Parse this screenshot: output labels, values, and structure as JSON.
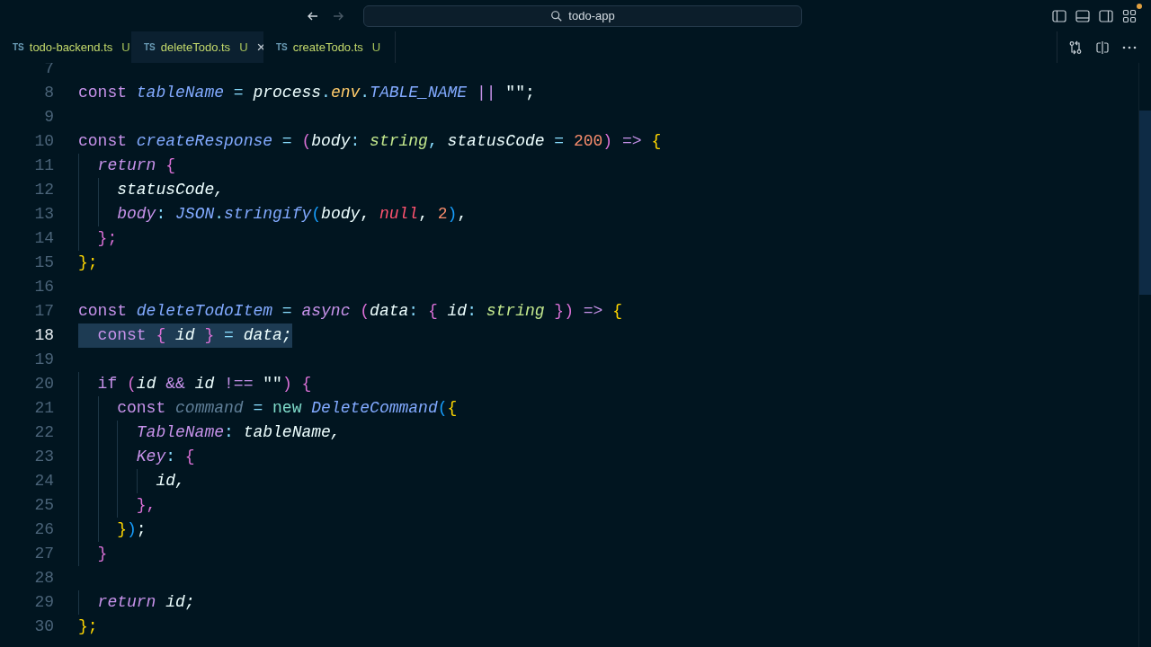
{
  "title_bar": {
    "search": {
      "value": "todo-app"
    },
    "back": {
      "disabled": false
    },
    "forward": {
      "disabled": true
    },
    "accounts_badge": {
      "color": "#e0a040"
    }
  },
  "tabs": [
    {
      "lang": "TS",
      "label": "todo-backend.ts",
      "status": "U",
      "selected": false
    },
    {
      "lang": "TS",
      "label": "deleteTodo.ts",
      "status": "U",
      "selected": true,
      "close": "×"
    },
    {
      "lang": "TS",
      "label": "createTodo.ts",
      "status": "U",
      "selected": false
    }
  ],
  "editor": {
    "lines": [
      {
        "n": "7",
        "selected": false
      },
      {
        "n": "8",
        "selected": false,
        "tokens": [
          {
            "t": "const ",
            "kind": "kw"
          },
          {
            "t": "tableName",
            "kind": "fn"
          },
          {
            "t": " = ",
            "kind": "op"
          },
          {
            "t": "process",
            "kind": "var"
          },
          {
            "t": ".",
            "kind": "op"
          },
          {
            "t": "env",
            "kind": "prop"
          },
          {
            "t": ".",
            "kind": "op"
          },
          {
            "t": "TABLE_NAME",
            "kind": "fn"
          },
          {
            "t": " || ",
            "kind": "kw"
          },
          {
            "t": "\"\";",
            "kind": "plain"
          }
        ]
      },
      {
        "n": "9",
        "selected": false
      },
      {
        "n": "10",
        "selected": false,
        "tokens": [
          {
            "t": "const ",
            "kind": "kw"
          },
          {
            "t": "createResponse",
            "kind": "fn"
          },
          {
            "t": " = ",
            "kind": "op"
          },
          {
            "t": "(",
            "kind": "paren"
          },
          {
            "t": "body",
            "kind": "var"
          },
          {
            "t": ": ",
            "kind": "op"
          },
          {
            "t": "string",
            "kind": "type"
          },
          {
            "t": ", ",
            "kind": "op"
          },
          {
            "t": "statusCode",
            "kind": "var"
          },
          {
            "t": " = ",
            "kind": "op"
          },
          {
            "t": "200",
            "kind": "num"
          },
          {
            "t": ")",
            "kind": "paren"
          },
          {
            "t": " => ",
            "kind": "kw"
          },
          {
            "t": "{",
            "kind": "brace"
          }
        ]
      },
      {
        "n": "11",
        "selected": false,
        "tokens": [
          {
            "t": "  return ",
            "kind": "kwi"
          },
          {
            "t": "{",
            "kind": "paren"
          }
        ]
      },
      {
        "n": "12",
        "selected": false,
        "tokens": [
          {
            "t": "    statusCode,",
            "kind": "var"
          }
        ]
      },
      {
        "n": "13",
        "selected": false,
        "tokens": [
          {
            "t": "    body",
            "kind": "key"
          },
          {
            "t": ": ",
            "kind": "op"
          },
          {
            "t": "JSON",
            "kind": "fn"
          },
          {
            "t": ".",
            "kind": "op"
          },
          {
            "t": "stringify",
            "kind": "fn"
          },
          {
            "t": "(",
            "kind": "blue"
          },
          {
            "t": "body",
            "kind": "var"
          },
          {
            "t": ", ",
            "kind": "plain"
          },
          {
            "t": "null",
            "kind": "nul"
          },
          {
            "t": ", ",
            "kind": "plain"
          },
          {
            "t": "2",
            "kind": "num"
          },
          {
            "t": ")",
            "kind": "blue"
          },
          {
            "t": ",",
            "kind": "plain"
          }
        ]
      },
      {
        "n": "14",
        "selected": false,
        "tokens": [
          {
            "t": "  };",
            "kind": "paren"
          }
        ]
      },
      {
        "n": "15",
        "selected": false,
        "tokens": [
          {
            "t": "};",
            "kind": "brace"
          }
        ]
      },
      {
        "n": "16",
        "selected": false
      },
      {
        "n": "17",
        "selected": false,
        "tokens": [
          {
            "t": "const ",
            "kind": "kw"
          },
          {
            "t": "deleteTodoItem",
            "kind": "fn"
          },
          {
            "t": " = ",
            "kind": "op"
          },
          {
            "t": "async ",
            "kind": "kwi"
          },
          {
            "t": "(",
            "kind": "paren"
          },
          {
            "t": "data",
            "kind": "var"
          },
          {
            "t": ": ",
            "kind": "op"
          },
          {
            "t": "{ ",
            "kind": "paren"
          },
          {
            "t": "id",
            "kind": "var"
          },
          {
            "t": ": ",
            "kind": "op"
          },
          {
            "t": "string",
            "kind": "type"
          },
          {
            "t": " }",
            "kind": "paren"
          },
          {
            "t": ")",
            "kind": "paren"
          },
          {
            "t": " => ",
            "kind": "kw"
          },
          {
            "t": "{",
            "kind": "brace"
          }
        ]
      },
      {
        "n": "18",
        "selected": true,
        "tokens": [
          {
            "t": "  const ",
            "kind": "kw"
          },
          {
            "t": "{ ",
            "kind": "paren"
          },
          {
            "t": "id",
            "kind": "var"
          },
          {
            "t": " } ",
            "kind": "paren"
          },
          {
            "t": "= ",
            "kind": "op"
          },
          {
            "t": "data;",
            "kind": "var"
          }
        ]
      },
      {
        "n": "19",
        "selected": false
      },
      {
        "n": "20",
        "selected": false,
        "tokens": [
          {
            "t": "  if ",
            "kind": "kw"
          },
          {
            "t": "(",
            "kind": "paren"
          },
          {
            "t": "id",
            "kind": "var"
          },
          {
            "t": " && ",
            "kind": "kw"
          },
          {
            "t": "id",
            "kind": "var"
          },
          {
            "t": " !== ",
            "kind": "kw"
          },
          {
            "t": "\"\"",
            "kind": "plain"
          },
          {
            "t": ") ",
            "kind": "paren"
          },
          {
            "t": "{",
            "kind": "paren"
          }
        ]
      },
      {
        "n": "21",
        "selected": false,
        "tokens": [
          {
            "t": "    const ",
            "kind": "kw"
          },
          {
            "t": "command",
            "kind": "dim"
          },
          {
            "t": " = ",
            "kind": "op"
          },
          {
            "t": "new ",
            "kind": "new"
          },
          {
            "t": "DeleteCommand",
            "kind": "fn"
          },
          {
            "t": "(",
            "kind": "blue"
          },
          {
            "t": "{",
            "kind": "brace"
          }
        ]
      },
      {
        "n": "22",
        "selected": false,
        "tokens": [
          {
            "t": "      TableName",
            "kind": "key"
          },
          {
            "t": ": ",
            "kind": "op"
          },
          {
            "t": "tableName,",
            "kind": "var"
          }
        ]
      },
      {
        "n": "23",
        "selected": false,
        "tokens": [
          {
            "t": "      Key",
            "kind": "key"
          },
          {
            "t": ": ",
            "kind": "op"
          },
          {
            "t": "{",
            "kind": "paren"
          }
        ]
      },
      {
        "n": "24",
        "selected": false,
        "tokens": [
          {
            "t": "        id,",
            "kind": "var"
          }
        ]
      },
      {
        "n": "25",
        "selected": false,
        "tokens": [
          {
            "t": "      },",
            "kind": "paren"
          }
        ]
      },
      {
        "n": "26",
        "selected": false,
        "tokens": [
          {
            "t": "    }",
            "kind": "brace"
          },
          {
            "t": ")",
            "kind": "blue"
          },
          {
            "t": ";",
            "kind": "plain"
          }
        ]
      },
      {
        "n": "27",
        "selected": false,
        "tokens": [
          {
            "t": "  }",
            "kind": "paren"
          }
        ]
      },
      {
        "n": "28",
        "selected": false
      },
      {
        "n": "29",
        "selected": false,
        "tokens": [
          {
            "t": "  return ",
            "kind": "kwi"
          },
          {
            "t": "id;",
            "kind": "var"
          }
        ]
      },
      {
        "n": "30",
        "selected": false,
        "tokens": [
          {
            "t": "};",
            "kind": "brace"
          }
        ]
      }
    ]
  }
}
